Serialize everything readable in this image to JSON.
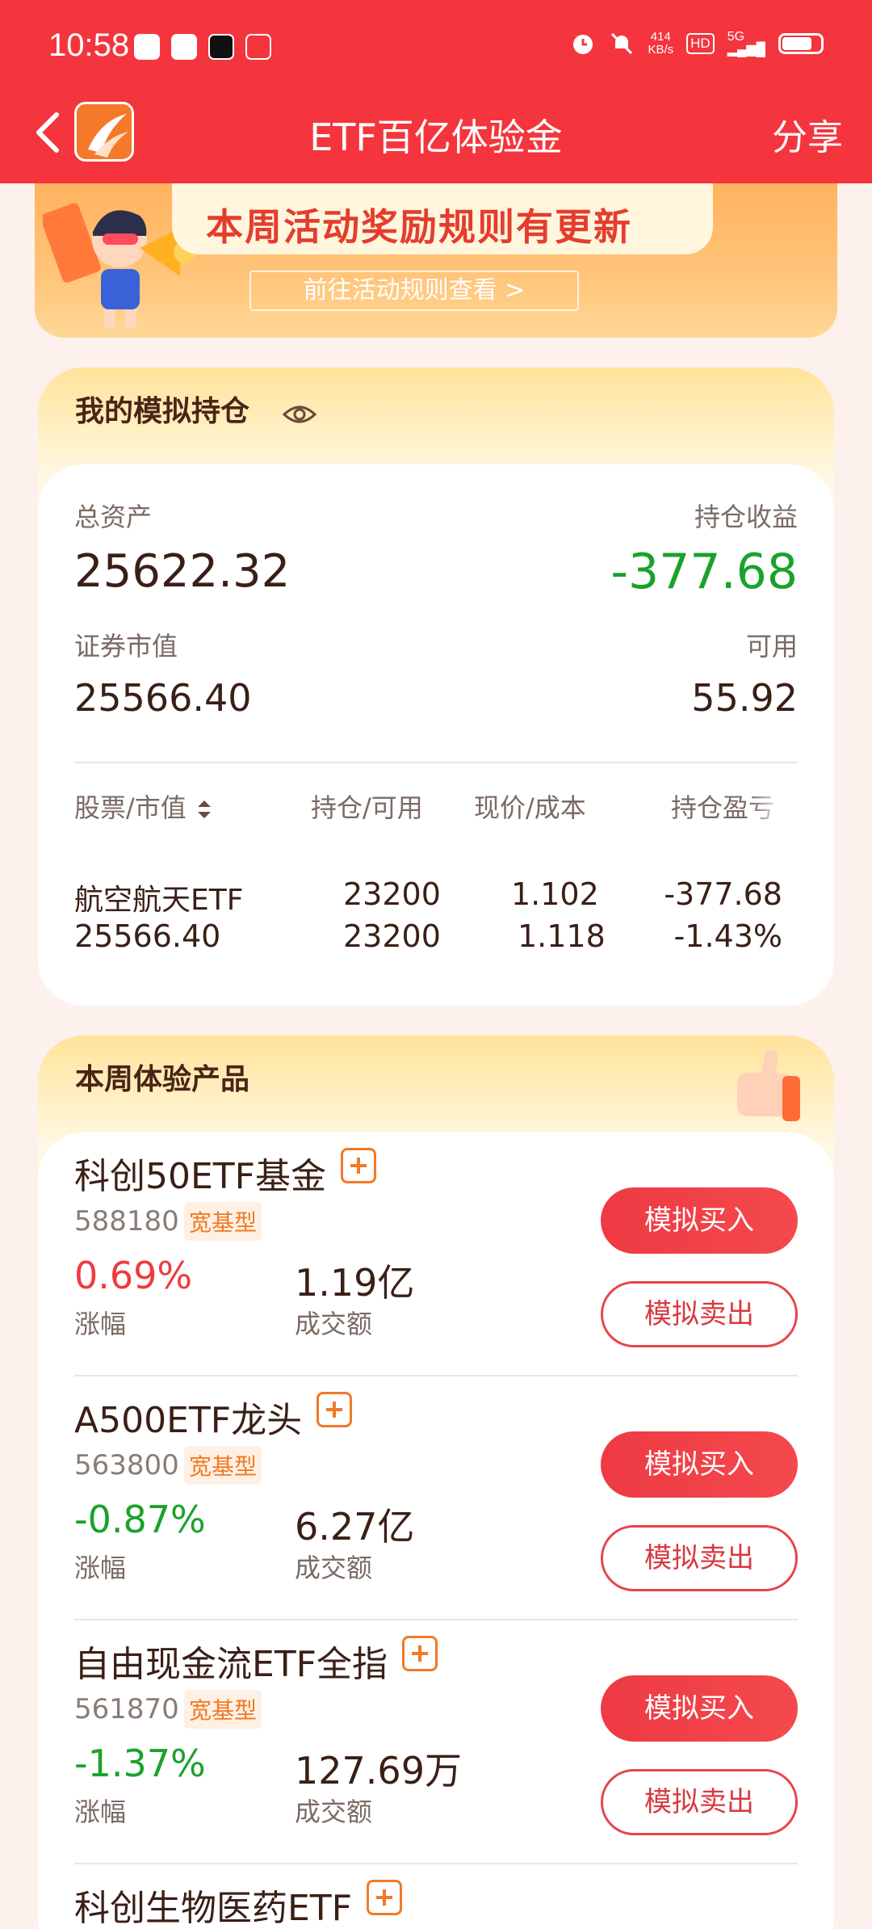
{
  "status_bar": {
    "time": "10:58",
    "net_speed_value": "414",
    "net_speed_unit": "KB/s",
    "hd": "HD",
    "network": "5G"
  },
  "nav": {
    "title": "ETF百亿体验金",
    "share_label": "分享"
  },
  "banner": {
    "headline": "本周活动奖励规则有更新",
    "cta": "前往活动规则查看 >"
  },
  "holdings": {
    "title": "我的模拟持仓",
    "total_assets_label": "总资产",
    "total_assets": "25622.32",
    "pnl_label": "持仓收益",
    "pnl": "-377.68",
    "market_value_label": "证券市值",
    "market_value": "25566.40",
    "available_label": "可用",
    "available": "55.92",
    "columns": [
      "股票/市值",
      "持仓/可用",
      "现价/成本",
      "持仓盈亏"
    ],
    "rows": [
      {
        "name": "航空航天ETF",
        "value": "25566.40",
        "position": "23200",
        "available": "23200",
        "price": "1.102",
        "cost": "1.118",
        "pnl": "-377.68",
        "pnl_pct": "-1.43%"
      }
    ]
  },
  "products": {
    "title": "本周体验产品",
    "change_label": "涨幅",
    "volume_label": "成交额",
    "buy_label": "模拟买入",
    "sell_label": "模拟卖出",
    "items": [
      {
        "name": "科创50ETF基金",
        "code": "588180",
        "tag": "宽基型",
        "change": "0.69%",
        "volume": "1.19亿",
        "direction": "up"
      },
      {
        "name": "A500ETF龙头",
        "code": "563800",
        "tag": "宽基型",
        "change": "-0.87%",
        "volume": "6.27亿",
        "direction": "down"
      },
      {
        "name": "自由现金流ETF全指",
        "code": "561870",
        "tag": "宽基型",
        "change": "-1.37%",
        "volume": "127.69万",
        "direction": "down"
      },
      {
        "name": "科创生物医药ETF",
        "code": "",
        "tag": "",
        "change": "",
        "volume": "",
        "direction": ""
      }
    ]
  },
  "colors": {
    "primary_red": "#f4353d",
    "down_green": "#1aa22b",
    "up_red": "#ee3b3f",
    "accent_orange": "#f07a26"
  }
}
